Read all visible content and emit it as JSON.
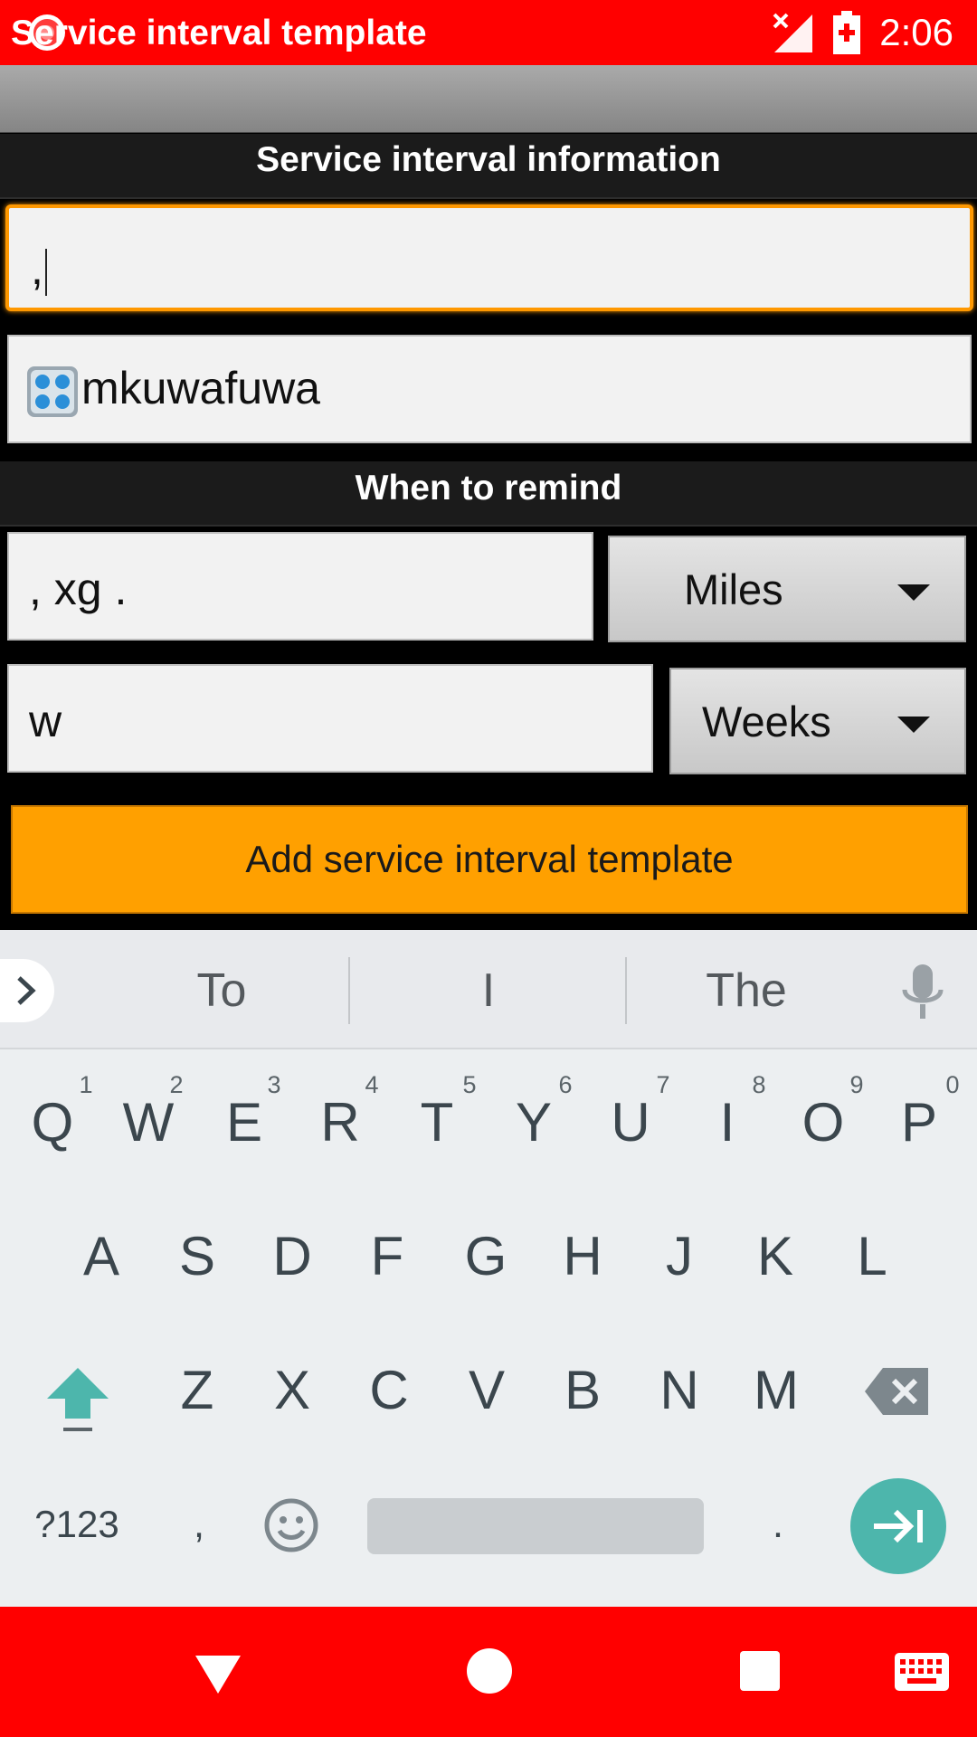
{
  "status_bar": {
    "time": "2:06",
    "icons": [
      "record-icon",
      "signal-off-icon",
      "battery-charging-icon"
    ]
  },
  "app": {
    "title": "Service interval template"
  },
  "sections": {
    "info": "Service interval information",
    "remind": "When to remind"
  },
  "form": {
    "name_value": ",",
    "description_value": "mkuwafuwa",
    "miles_value": ", xg .",
    "miles_unit": "Miles",
    "weeks_value": "w",
    "weeks_unit": "Weeks",
    "submit_label": "Add service interval template"
  },
  "keyboard": {
    "suggestions": [
      "To",
      "I",
      "The"
    ],
    "row1": [
      "Q",
      "W",
      "E",
      "R",
      "T",
      "Y",
      "U",
      "I",
      "O",
      "P"
    ],
    "row1_hints": [
      "1",
      "2",
      "3",
      "4",
      "5",
      "6",
      "7",
      "8",
      "9",
      "0"
    ],
    "row2": [
      "A",
      "S",
      "D",
      "F",
      "G",
      "H",
      "J",
      "K",
      "L"
    ],
    "row3": [
      "Z",
      "X",
      "C",
      "V",
      "B",
      "N",
      "M"
    ],
    "symbols_label": "?123",
    "comma": ",",
    "period": "."
  },
  "colors": {
    "status_bar": "#ff0000",
    "nav_bar": "#ff0000",
    "accent": "#ffa000",
    "focus": "#ff9800",
    "enter_key": "#4db6ac"
  }
}
